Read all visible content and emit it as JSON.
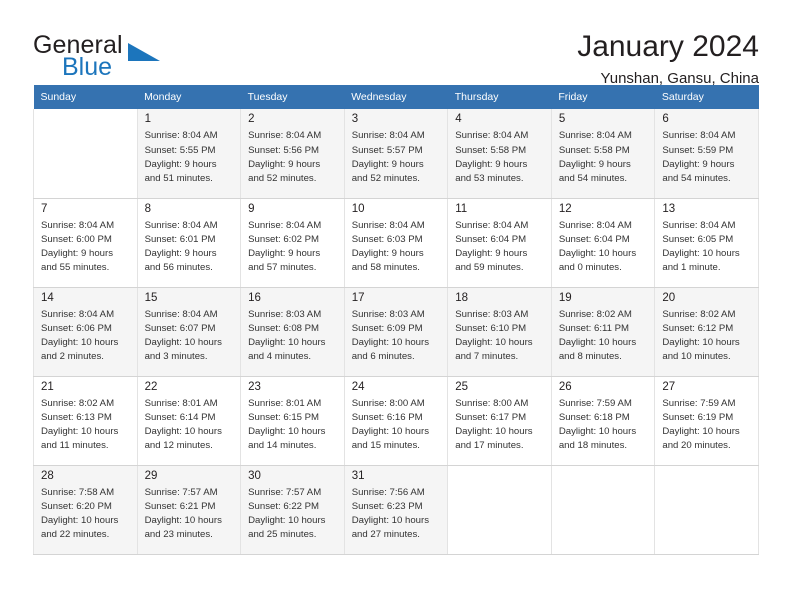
{
  "brand": {
    "name_part1": "General",
    "name_part2": "Blue",
    "mark_icon": "triangle-logo-icon"
  },
  "header": {
    "title": "January 2024",
    "subtitle": "Yunshan, Gansu, China"
  },
  "calendar": {
    "weekday_headers": [
      "Sunday",
      "Monday",
      "Tuesday",
      "Wednesday",
      "Thursday",
      "Friday",
      "Saturday"
    ],
    "accent_color": "#3572b0",
    "alt_row_color": "#f5f5f5",
    "weeks": [
      [
        {
          "day": "",
          "info": ""
        },
        {
          "day": "1",
          "info": "Sunrise: 8:04 AM\nSunset: 5:55 PM\nDaylight: 9 hours\nand 51 minutes."
        },
        {
          "day": "2",
          "info": "Sunrise: 8:04 AM\nSunset: 5:56 PM\nDaylight: 9 hours\nand 52 minutes."
        },
        {
          "day": "3",
          "info": "Sunrise: 8:04 AM\nSunset: 5:57 PM\nDaylight: 9 hours\nand 52 minutes."
        },
        {
          "day": "4",
          "info": "Sunrise: 8:04 AM\nSunset: 5:58 PM\nDaylight: 9 hours\nand 53 minutes."
        },
        {
          "day": "5",
          "info": "Sunrise: 8:04 AM\nSunset: 5:58 PM\nDaylight: 9 hours\nand 54 minutes."
        },
        {
          "day": "6",
          "info": "Sunrise: 8:04 AM\nSunset: 5:59 PM\nDaylight: 9 hours\nand 54 minutes."
        }
      ],
      [
        {
          "day": "7",
          "info": "Sunrise: 8:04 AM\nSunset: 6:00 PM\nDaylight: 9 hours\nand 55 minutes."
        },
        {
          "day": "8",
          "info": "Sunrise: 8:04 AM\nSunset: 6:01 PM\nDaylight: 9 hours\nand 56 minutes."
        },
        {
          "day": "9",
          "info": "Sunrise: 8:04 AM\nSunset: 6:02 PM\nDaylight: 9 hours\nand 57 minutes."
        },
        {
          "day": "10",
          "info": "Sunrise: 8:04 AM\nSunset: 6:03 PM\nDaylight: 9 hours\nand 58 minutes."
        },
        {
          "day": "11",
          "info": "Sunrise: 8:04 AM\nSunset: 6:04 PM\nDaylight: 9 hours\nand 59 minutes."
        },
        {
          "day": "12",
          "info": "Sunrise: 8:04 AM\nSunset: 6:04 PM\nDaylight: 10 hours\nand 0 minutes."
        },
        {
          "day": "13",
          "info": "Sunrise: 8:04 AM\nSunset: 6:05 PM\nDaylight: 10 hours\nand 1 minute."
        }
      ],
      [
        {
          "day": "14",
          "info": "Sunrise: 8:04 AM\nSunset: 6:06 PM\nDaylight: 10 hours\nand 2 minutes."
        },
        {
          "day": "15",
          "info": "Sunrise: 8:04 AM\nSunset: 6:07 PM\nDaylight: 10 hours\nand 3 minutes."
        },
        {
          "day": "16",
          "info": "Sunrise: 8:03 AM\nSunset: 6:08 PM\nDaylight: 10 hours\nand 4 minutes."
        },
        {
          "day": "17",
          "info": "Sunrise: 8:03 AM\nSunset: 6:09 PM\nDaylight: 10 hours\nand 6 minutes."
        },
        {
          "day": "18",
          "info": "Sunrise: 8:03 AM\nSunset: 6:10 PM\nDaylight: 10 hours\nand 7 minutes."
        },
        {
          "day": "19",
          "info": "Sunrise: 8:02 AM\nSunset: 6:11 PM\nDaylight: 10 hours\nand 8 minutes."
        },
        {
          "day": "20",
          "info": "Sunrise: 8:02 AM\nSunset: 6:12 PM\nDaylight: 10 hours\nand 10 minutes."
        }
      ],
      [
        {
          "day": "21",
          "info": "Sunrise: 8:02 AM\nSunset: 6:13 PM\nDaylight: 10 hours\nand 11 minutes."
        },
        {
          "day": "22",
          "info": "Sunrise: 8:01 AM\nSunset: 6:14 PM\nDaylight: 10 hours\nand 12 minutes."
        },
        {
          "day": "23",
          "info": "Sunrise: 8:01 AM\nSunset: 6:15 PM\nDaylight: 10 hours\nand 14 minutes."
        },
        {
          "day": "24",
          "info": "Sunrise: 8:00 AM\nSunset: 6:16 PM\nDaylight: 10 hours\nand 15 minutes."
        },
        {
          "day": "25",
          "info": "Sunrise: 8:00 AM\nSunset: 6:17 PM\nDaylight: 10 hours\nand 17 minutes."
        },
        {
          "day": "26",
          "info": "Sunrise: 7:59 AM\nSunset: 6:18 PM\nDaylight: 10 hours\nand 18 minutes."
        },
        {
          "day": "27",
          "info": "Sunrise: 7:59 AM\nSunset: 6:19 PM\nDaylight: 10 hours\nand 20 minutes."
        }
      ],
      [
        {
          "day": "28",
          "info": "Sunrise: 7:58 AM\nSunset: 6:20 PM\nDaylight: 10 hours\nand 22 minutes."
        },
        {
          "day": "29",
          "info": "Sunrise: 7:57 AM\nSunset: 6:21 PM\nDaylight: 10 hours\nand 23 minutes."
        },
        {
          "day": "30",
          "info": "Sunrise: 7:57 AM\nSunset: 6:22 PM\nDaylight: 10 hours\nand 25 minutes."
        },
        {
          "day": "31",
          "info": "Sunrise: 7:56 AM\nSunset: 6:23 PM\nDaylight: 10 hours\nand 27 minutes."
        },
        {
          "day": "",
          "info": ""
        },
        {
          "day": "",
          "info": ""
        },
        {
          "day": "",
          "info": ""
        }
      ]
    ]
  }
}
